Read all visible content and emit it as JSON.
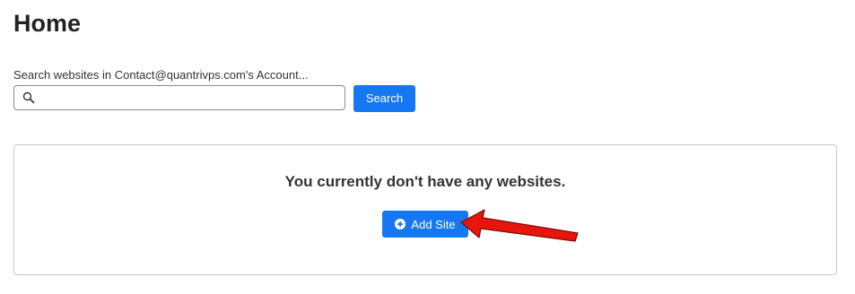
{
  "page": {
    "title": "Home"
  },
  "search": {
    "label": "Search websites in Contact@quantrivps.com's Account...",
    "value": "",
    "placeholder": "",
    "button_label": "Search",
    "icon": "search-icon"
  },
  "sites_panel": {
    "empty_message": "You currently don't have any websites.",
    "add_button_label": "Add Site",
    "add_button_icon": "plus-circle-icon"
  },
  "annotation": {
    "type": "arrow",
    "color": "#e8150f"
  },
  "colors": {
    "accent": "#1677f2",
    "text": "#222222",
    "border": "#c9c9c9"
  }
}
